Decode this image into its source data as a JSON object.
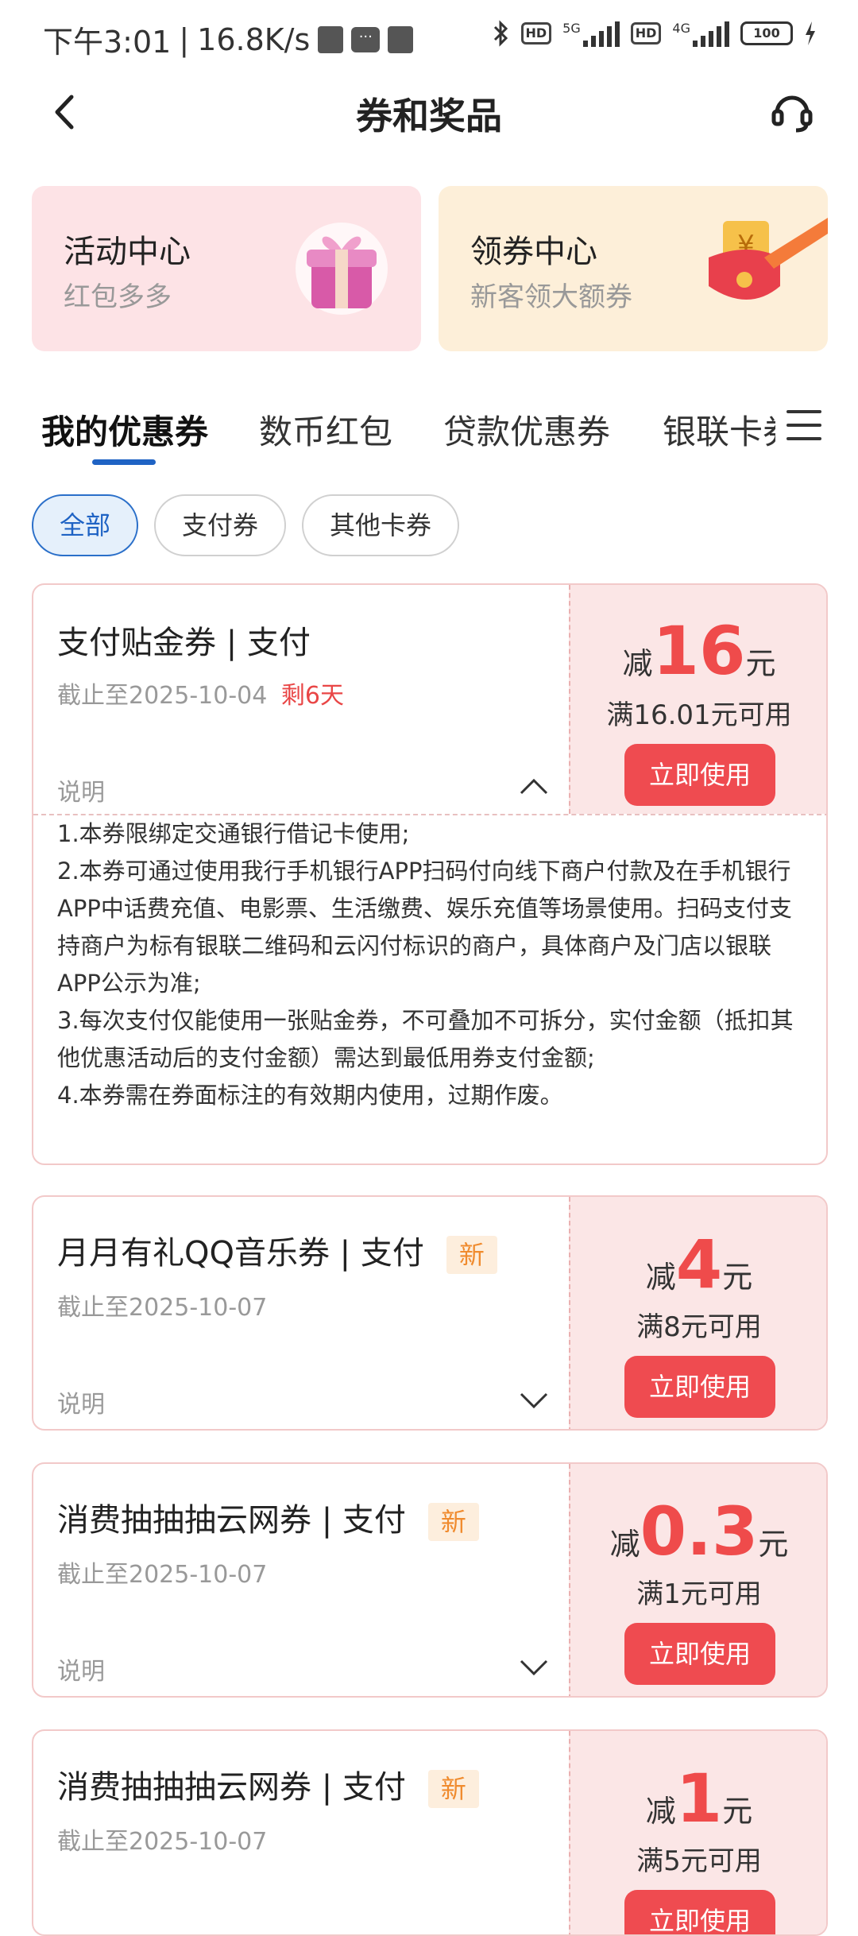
{
  "status_bar": {
    "time": "下午3:01",
    "speed": "16.8K/s",
    "hd1": "HD",
    "net1": "5G",
    "hd2": "HD",
    "net2": "4G",
    "battery": "100"
  },
  "header": {
    "title": "券和奖品",
    "back_icon": "chevron-left-icon",
    "service_icon": "headset-icon"
  },
  "promo_cards": [
    {
      "title": "活动中心",
      "subtitle": "红包多多",
      "icon": "gift-box-icon",
      "bg": "#fde3e6"
    },
    {
      "title": "领券中心",
      "subtitle": "新客领大额券",
      "icon": "red-envelope-icon",
      "bg": "#fdefd9"
    }
  ],
  "tabs": [
    {
      "label": "我的优惠券",
      "active": true
    },
    {
      "label": "数币红包"
    },
    {
      "label": "贷款优惠券"
    },
    {
      "label": "银联卡券"
    }
  ],
  "filters": [
    {
      "label": "全部",
      "selected": true
    },
    {
      "label": "支付券"
    },
    {
      "label": "其他卡券"
    }
  ],
  "coupons": [
    {
      "title": "支付贴金券 | 支付",
      "deadline": "截止至2025-10-04",
      "remain": "剩6天",
      "desc_label": "说明",
      "prefix": "减",
      "amount": "16",
      "unit": "元",
      "condition": "满16.01元可用",
      "button": "立即使用",
      "expanded": true,
      "rules": [
        "1.本券限绑定交通银行借记卡使用;",
        "2.本券可通过使用我行手机银行APP扫码付向线下商户付款及在手机银行APP中话费充值、电影票、生活缴费、娱乐充值等场景使用。扫码支付支持商户为标有银联二维码和云闪付标识的商户，具体商户及门店以银联APP公示为准;",
        "3.每次支付仅能使用一张贴金券，不可叠加不可拆分，实付金额（抵扣其他优惠活动后的支付金额）需达到最低用券支付金额;",
        "4.本券需在券面标注的有效期内使用，过期作废。"
      ]
    },
    {
      "title": "月月有礼QQ音乐券 | 支付",
      "tag": "新",
      "deadline": "截止至2025-10-07",
      "desc_label": "说明",
      "prefix": "减",
      "amount": "4",
      "unit": "元",
      "condition": "满8元可用",
      "button": "立即使用"
    },
    {
      "title": "消费抽抽抽云网券 | 支付",
      "tag": "新",
      "deadline": "截止至2025-10-07",
      "desc_label": "说明",
      "prefix": "减",
      "amount": "0.3",
      "unit": "元",
      "condition": "满1元可用",
      "button": "立即使用"
    },
    {
      "title": "消费抽抽抽云网券 | 支付",
      "tag": "新",
      "deadline": "截止至2025-10-07",
      "prefix": "减",
      "amount": "1",
      "unit": "元",
      "condition": "满5元可用",
      "button": "立即使用"
    }
  ],
  "colors": {
    "accent": "#1f63c4",
    "red": "#ef4b4b",
    "tag_orange": "#f08b2e"
  }
}
